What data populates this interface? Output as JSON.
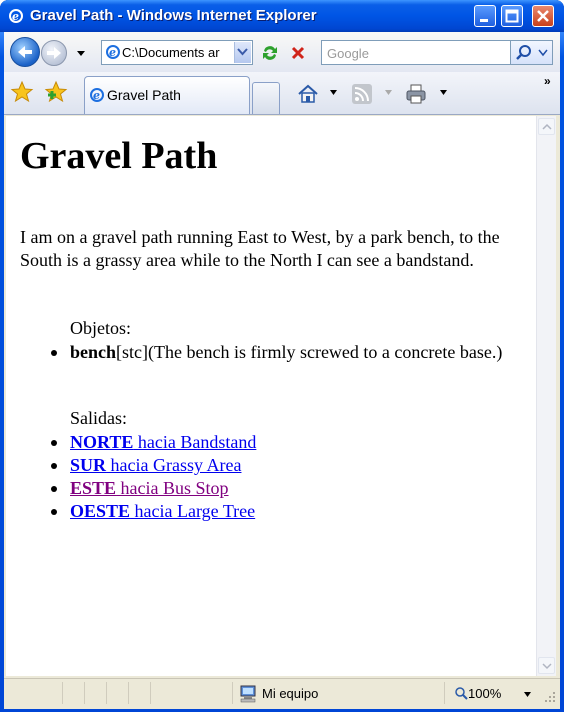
{
  "window": {
    "title": "Gravel Path - Windows Internet Explorer"
  },
  "address_bar": {
    "value": "C:\\Documents ar"
  },
  "search": {
    "placeholder": "Google"
  },
  "tab": {
    "label": "Gravel Path"
  },
  "toolbar": {
    "overflow": "»"
  },
  "page": {
    "heading": "Gravel Path",
    "description": "I am on a gravel path running East to West, by a park bench, to the South is a grassy area while to the North I can see a bandstand.",
    "objects_label": "Objetos:",
    "objects": [
      {
        "name": "bench",
        "detail": "[stc](The bench is firmly screwed to a concrete base.)"
      }
    ],
    "exits_label": "Salidas:",
    "exits": [
      {
        "direction": "NORTE",
        "text": " hacia Bandstand",
        "visited": false
      },
      {
        "direction": "SUR",
        "text": " hacia Grassy Area",
        "visited": false
      },
      {
        "direction": "ESTE",
        "text": " hacia Bus Stop",
        "visited": true
      },
      {
        "direction": "OESTE",
        "text": " hacia Large Tree",
        "visited": false
      }
    ]
  },
  "status_bar": {
    "zone": "Mi equipo",
    "zoom": "100%"
  },
  "colors": {
    "link": "#0000ee",
    "visited_link": "#800080",
    "titlebar": "#0055e5"
  }
}
